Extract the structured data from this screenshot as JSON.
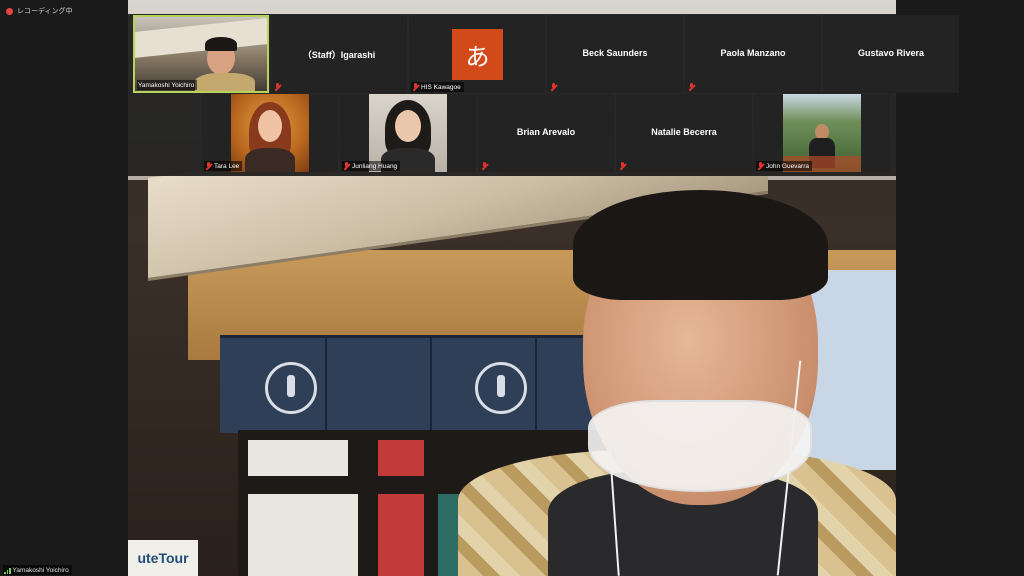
{
  "recording": {
    "label": "レコーディング中",
    "color": "#e8463f"
  },
  "main_speaker": {
    "name": "Yamakoshi Yoichiro"
  },
  "scene_signs": {
    "tour": "uteTour"
  },
  "gallery": {
    "row1": [
      {
        "name": "Yamakoshi Yoichiro",
        "type": "video",
        "active": true,
        "muted": false
      },
      {
        "name": "（Staff）Igarashi",
        "type": "name",
        "muted": true,
        "show_bottom_name": false
      },
      {
        "name": "HIS Kawagoe",
        "type": "avatar",
        "avatar_char": "あ",
        "muted": true
      },
      {
        "name": "Beck Saunders",
        "type": "name",
        "muted": true,
        "show_bottom_name": false
      },
      {
        "name": "Paola Manzano",
        "type": "name",
        "muted": true,
        "show_bottom_name": false
      },
      {
        "name": "Gustavo Rivera",
        "type": "name",
        "muted": false,
        "show_bottom_name": false
      }
    ],
    "row2": [
      {
        "name": "Tara Lee",
        "type": "video",
        "muted": true
      },
      {
        "name": "Junliang Huang",
        "type": "video",
        "muted": true
      },
      {
        "name": "Brian Arevalo",
        "type": "name",
        "muted": true,
        "show_bottom_name": false
      },
      {
        "name": "Natalie Becerra",
        "type": "name",
        "muted": true,
        "show_bottom_name": false
      },
      {
        "name": "John Guevarra",
        "type": "video",
        "muted": true
      }
    ]
  },
  "colors": {
    "active_border": "#b9d25a",
    "muted": "#e0322c",
    "avatar_bg": "#d24a1a"
  }
}
